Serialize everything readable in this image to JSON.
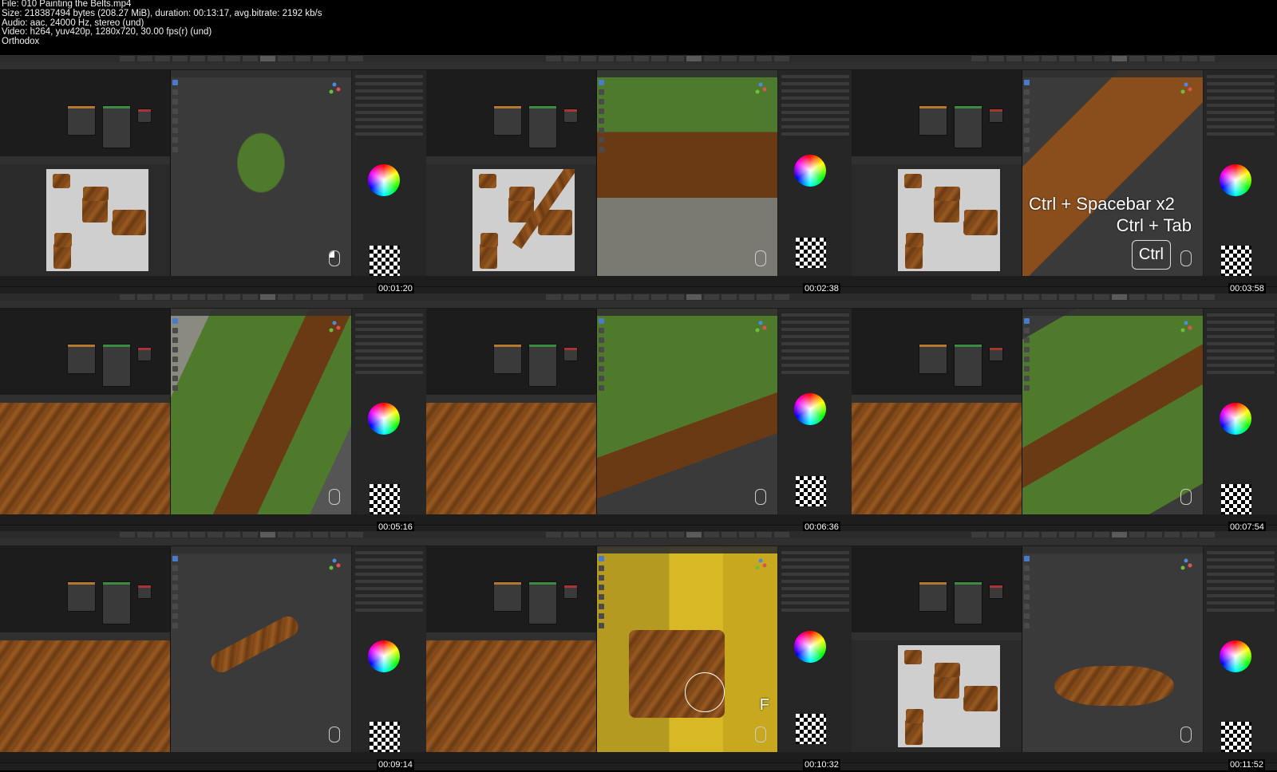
{
  "header": {
    "file_line": "File: 010 Painting the Belts.mp4",
    "size_line": "Size: 218387494 bytes (208.27 MiB), duration: 00:13:17, avg.bitrate: 2192 kb/s",
    "audio_line": "Audio: aac, 24000 Hz, stereo (und)",
    "video_line": "Video: h264, yuv420p, 1280x720, 30.00 fps(r) (und)",
    "author_line": "Orthodox"
  },
  "thumbnails": [
    {
      "timestamp": "00:01:20",
      "scene": "orc-full-body"
    },
    {
      "timestamp": "00:02:38",
      "scene": "belt-closeup"
    },
    {
      "timestamp": "00:03:58",
      "scene": "strap-wireframe",
      "overlay_line1": "Ctrl + Spacebar x2",
      "overlay_line2": "Ctrl + Tab",
      "key_label": "Ctrl"
    },
    {
      "timestamp": "00:05:16",
      "scene": "chest-strap"
    },
    {
      "timestamp": "00:06:36",
      "scene": "chest-strap-2"
    },
    {
      "timestamp": "00:07:54",
      "scene": "back-strap"
    },
    {
      "timestamp": "00:09:14",
      "scene": "floating-belt"
    },
    {
      "timestamp": "00:10:32",
      "scene": "leather-bag",
      "key_label": "F"
    },
    {
      "timestamp": "00:11:52",
      "scene": "belt-ring"
    }
  ],
  "colors": {
    "background": "#000000",
    "blender_accent": "#4a7ac8",
    "orc_skin": "#4f7a2c",
    "leather": "#8a4e1c"
  }
}
